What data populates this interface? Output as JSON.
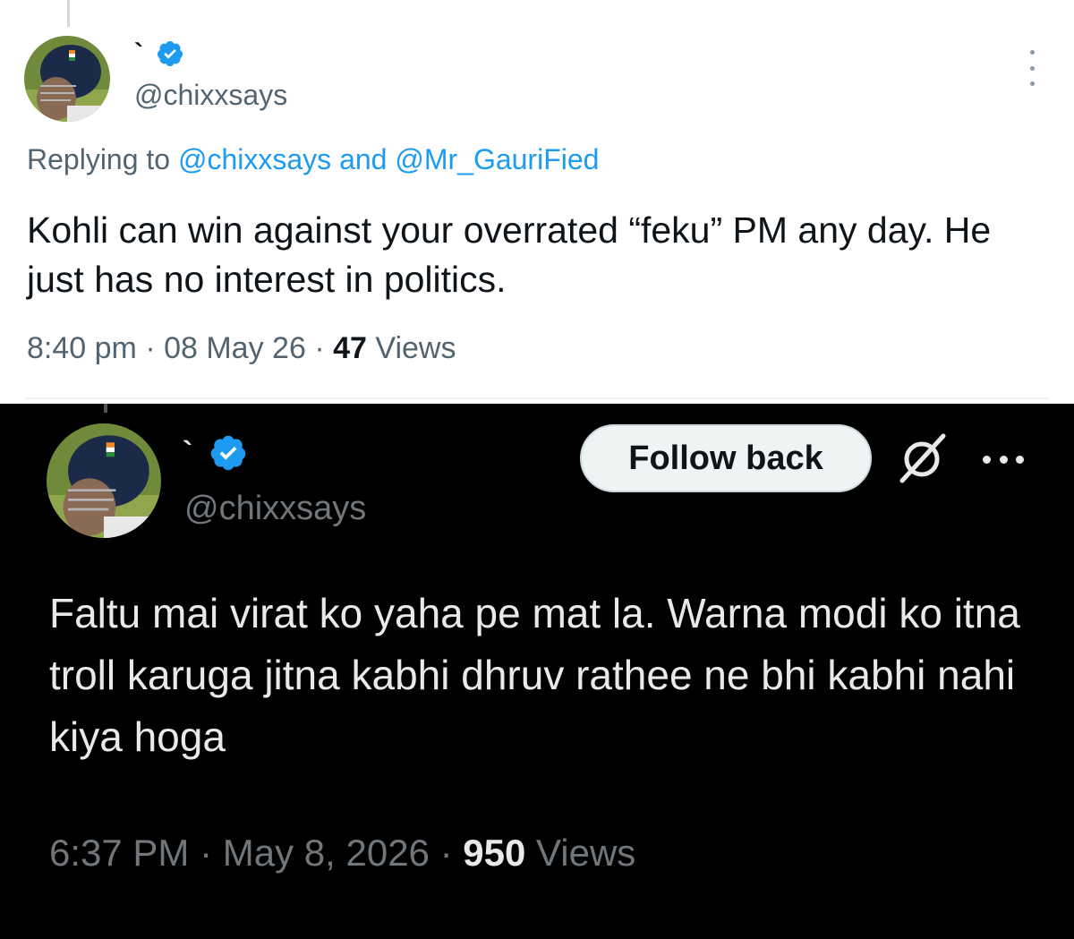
{
  "top_tweet": {
    "display_name": "`",
    "handle": "@chixxsays",
    "replying_prefix": "Replying to",
    "replying_mention_1": "@chixxsays",
    "replying_and": "and",
    "replying_mention_2": "@Mr_GauriFied",
    "text": "Kohli can win against your overrated “feku” PM any day. He just has no interest in politics.",
    "time": "8:40 pm",
    "date": "08 May 26",
    "separator": "·",
    "views_count": "47",
    "views_label": "Views",
    "verified_color": "#1d9bf0"
  },
  "bottom_tweet": {
    "display_name": "`",
    "handle": "@chixxsays",
    "follow_label": "Follow back",
    "text": "Faltu mai virat ko yaha pe mat la. Warna modi ko itna troll karuga jitna kabhi dhruv rathee ne bhi kabhi nahi kiya hoga",
    "time": "6:37 PM",
    "date": "May 8, 2026",
    "separator": "·",
    "views_count": "950",
    "views_label": "Views",
    "verified_color": "#1d9bf0"
  },
  "icons": {
    "verified": "verified-badge-icon",
    "more_vertical": "more-vertical-icon",
    "more_horizontal": "more-horizontal-icon",
    "grok": "grok-icon"
  }
}
